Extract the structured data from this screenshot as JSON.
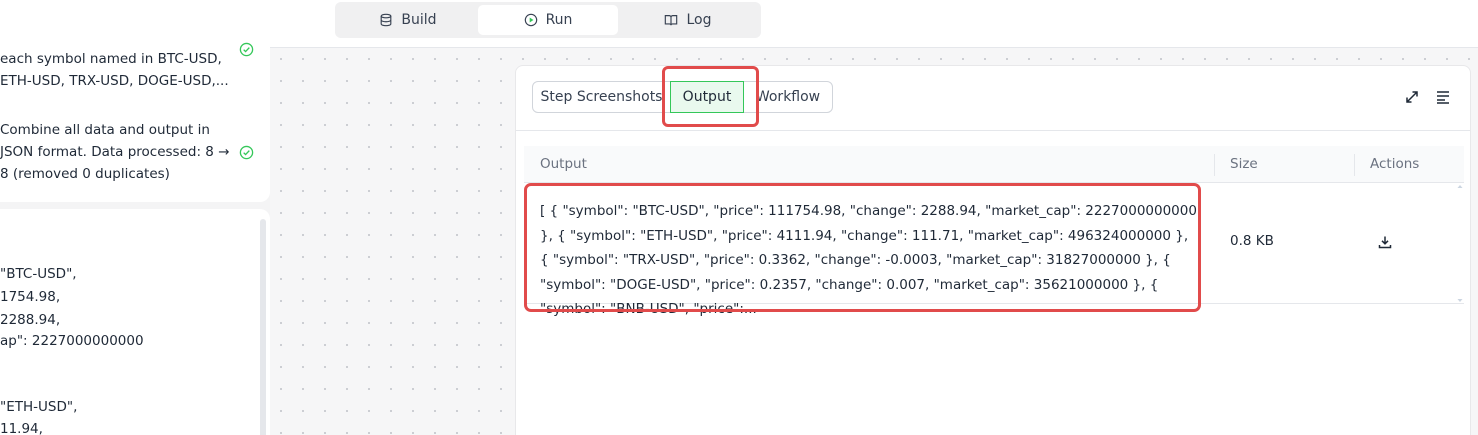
{
  "toolbar": {
    "tabs": [
      {
        "label": "Build",
        "icon": "database-icon"
      },
      {
        "label": "Run",
        "icon": "play-circle-icon"
      },
      {
        "label": "Log",
        "icon": "book-icon"
      }
    ],
    "active_tab": "Run"
  },
  "steps_card": {
    "steps": [
      {
        "text": "each symbol named in BTC-USD, ETH-USD, TRX-USD, DOGE-USD,...",
        "status": "done"
      },
      {
        "text": "Combine all data and output in JSON format. Data processed: 8 → 8 (removed 0 duplicates)",
        "status": "done"
      }
    ]
  },
  "preview_card": {
    "lines": [
      "\"BTC-USD\",",
      "1754.98,",
      "2288.94,",
      "ap\": 2227000000000",
      "\"ETH-USD\",",
      "11.94,"
    ]
  },
  "panel": {
    "segments": [
      "Step Screenshots",
      "Output",
      "Workflow"
    ],
    "active_segment": "Output",
    "table": {
      "headers": [
        "Output",
        "Size",
        "Actions"
      ],
      "rows": [
        {
          "output": "[ { \"symbol\": \"BTC-USD\", \"price\": 111754.98, \"change\": 2288.94, \"market_cap\": 2227000000000 }, { \"symbol\": \"ETH-USD\", \"price\": 4111.94, \"change\": 111.71, \"market_cap\": 496324000000 }, { \"symbol\": \"TRX-USD\", \"price\": 0.3362, \"change\": -0.0003, \"market_cap\": 31827000000 }, { \"symbol\": \"DOGE-USD\", \"price\": 0.2357, \"change\": 0.007, \"market_cap\": 35621000000 }, { \"symbol\": \"BNB-USD\", \"price\":...",
          "size": "0.8 KB",
          "action_icon": "download-icon"
        }
      ]
    }
  },
  "colors": {
    "accent_green": "#34c759",
    "highlight_red": "#e14b4b"
  }
}
